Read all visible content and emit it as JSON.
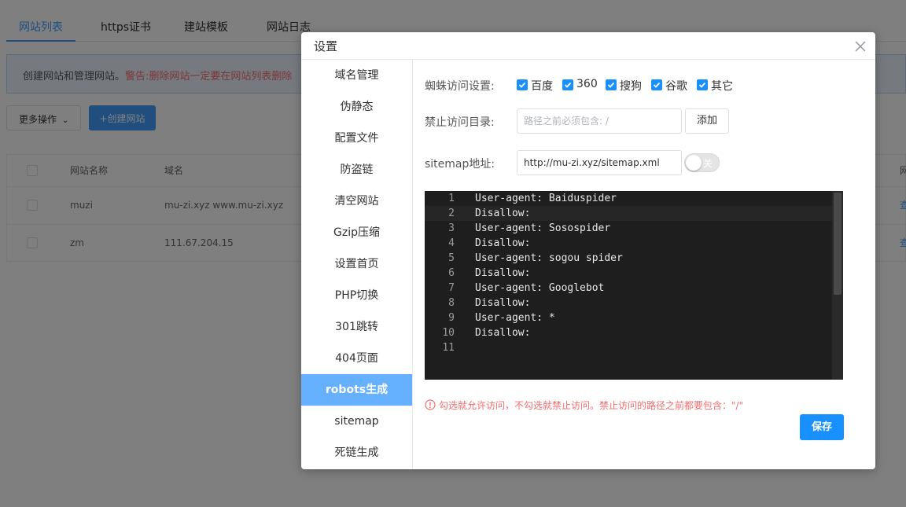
{
  "page_tabs": [
    {
      "label": "网站列表",
      "active": true
    },
    {
      "label": "https证书",
      "active": false
    },
    {
      "label": "建站模板",
      "active": false
    },
    {
      "label": "网站日志",
      "active": false
    }
  ],
  "notice": {
    "text": "创建网站和管理网站。",
    "warning": "警告:删除网站一定要在网站列表删除"
  },
  "toolbar": {
    "more_label": "更多操作",
    "create_label": "+创建网站"
  },
  "table": {
    "headers": [
      "网站名称",
      "域名",
      "网"
    ],
    "rows": [
      {
        "name": "muzi",
        "domain": "mu-zi.xyz www.mu-zi.xyz",
        "action": "查"
      },
      {
        "name": "zm",
        "domain": "111.67.204.15",
        "action": "查"
      }
    ]
  },
  "dialog": {
    "title": "设置",
    "sidebar": [
      {
        "label": "域名管理"
      },
      {
        "label": "伪静态"
      },
      {
        "label": "配置文件"
      },
      {
        "label": "防盗链"
      },
      {
        "label": "清空网站"
      },
      {
        "label": "Gzip压缩"
      },
      {
        "label": "设置首页"
      },
      {
        "label": "PHP切换"
      },
      {
        "label": "301跳转"
      },
      {
        "label": "404页面"
      },
      {
        "label": "robots生成"
      },
      {
        "label": "sitemap"
      },
      {
        "label": "死链生成"
      }
    ],
    "active_item": "robots生成",
    "spider_label": "蜘蛛访问设置:",
    "spiders": [
      {
        "label": "百度",
        "checked": true
      },
      {
        "label": "360",
        "checked": true
      },
      {
        "label": "搜狗",
        "checked": true
      },
      {
        "label": "谷歌",
        "checked": true
      },
      {
        "label": "其它",
        "checked": true
      }
    ],
    "forbid_label": "禁止访问目录:",
    "forbid_placeholder": "路径之前必须包含: /",
    "add_label": "添加",
    "sitemap_label": "sitemap地址:",
    "sitemap_value": "http://mu-zi.xyz/sitemap.xml",
    "switch": {
      "label": "关",
      "on": false
    },
    "editor_lines": [
      {
        "num": "1",
        "code": "User-agent: Baiduspider"
      },
      {
        "num": "2",
        "code": "Disallow:"
      },
      {
        "num": "3",
        "code": "User-agent: Sosospider"
      },
      {
        "num": "4",
        "code": "Disallow:"
      },
      {
        "num": "5",
        "code": "User-agent: sogou spider"
      },
      {
        "num": "6",
        "code": "Disallow:"
      },
      {
        "num": "7",
        "code": "User-agent: Googlebot"
      },
      {
        "num": "8",
        "code": "Disallow:"
      },
      {
        "num": "9",
        "code": "User-agent: *"
      },
      {
        "num": "10",
        "code": "Disallow:"
      },
      {
        "num": "11",
        "code": ""
      }
    ],
    "hint": "勾选就允许访问，不勾选就禁止访问。禁止访问的路径之前都要包含：\"/\"",
    "save_label": "保存"
  },
  "colors": {
    "primary": "#409eff",
    "active_sidebar": "#66b1ff",
    "warning": "#f56c6c",
    "editor_bg": "#1e1e1e"
  }
}
